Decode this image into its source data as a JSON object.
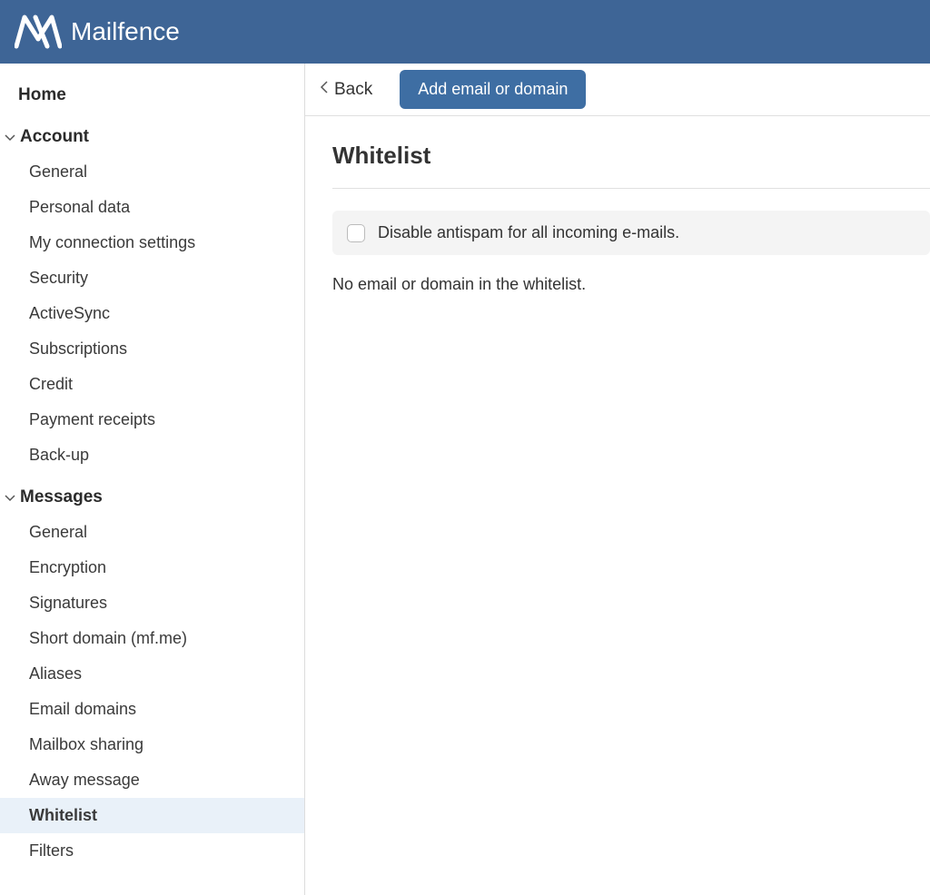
{
  "brand": {
    "name": "Mailfence"
  },
  "sidebar": {
    "home": "Home",
    "groups": [
      {
        "label": "Account",
        "items": [
          "General",
          "Personal data",
          "My connection settings",
          "Security",
          "ActiveSync",
          "Subscriptions",
          "Credit",
          "Payment receipts",
          "Back-up"
        ]
      },
      {
        "label": "Messages",
        "items": [
          "General",
          "Encryption",
          "Signatures",
          "Short domain (mf.me)",
          "Aliases",
          "Email domains",
          "Mailbox sharing",
          "Away message",
          "Whitelist",
          "Filters"
        ]
      }
    ],
    "active": "Whitelist"
  },
  "toolbar": {
    "back_label": "Back",
    "add_label": "Add email or domain"
  },
  "page": {
    "title": "Whitelist",
    "disable_antispam_label": "Disable antispam for all incoming e-mails.",
    "empty_message": "No email or domain in the whitelist."
  }
}
